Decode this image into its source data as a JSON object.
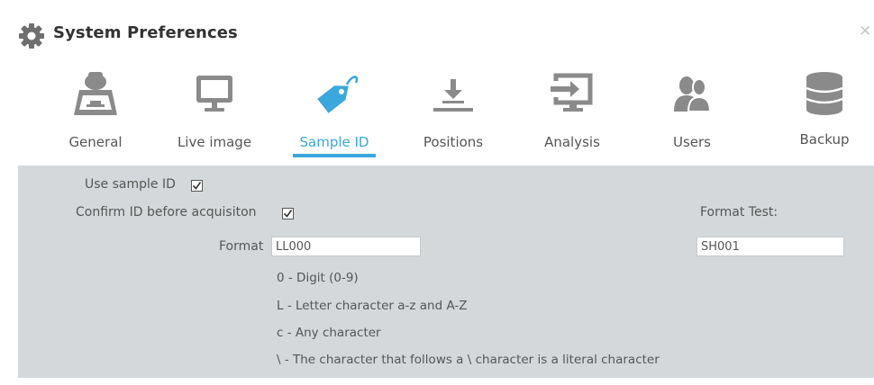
{
  "window": {
    "title": "System Preferences",
    "close_icon": "close-icon"
  },
  "tabs": [
    {
      "label": "General",
      "icon": "scanner-icon",
      "active": false
    },
    {
      "label": "Live image",
      "icon": "monitor-icon",
      "active": false
    },
    {
      "label": "Sample ID",
      "icon": "tag-icon",
      "active": true
    },
    {
      "label": "Positions",
      "icon": "download-tray-icon",
      "active": false
    },
    {
      "label": "Analysis",
      "icon": "screen-input-icon",
      "active": false
    },
    {
      "label": "Users",
      "icon": "users-icon",
      "active": false
    },
    {
      "label": "Backup",
      "icon": "database-icon",
      "active": false
    }
  ],
  "sample_id": {
    "use_sample_id_label": "Use sample ID",
    "use_sample_id_checked": true,
    "confirm_label": "Confirm ID before acquisiton",
    "confirm_checked": true,
    "format_label": "Format",
    "format_value": "LL000",
    "format_test_label": "Format Test:",
    "format_test_value": "SH001",
    "help": [
      "0 - Digit (0-9)",
      "L - Letter character a-z and A-Z",
      "c - Any character",
      "\\ - The character that follows a \\  character is a literal character"
    ]
  },
  "colors": {
    "accent": "#3aa7dd",
    "panel_background": "#d4d8da",
    "icon_gray": "#8a8a8a"
  }
}
